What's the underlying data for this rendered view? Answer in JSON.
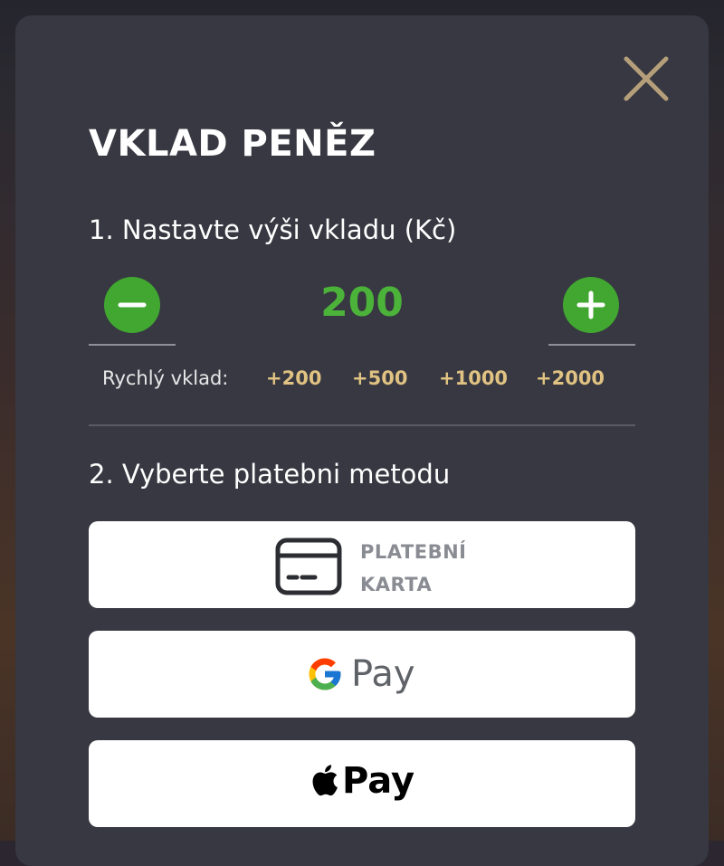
{
  "modal": {
    "title": "VKLAD PENĚZ",
    "close_icon": "close-icon"
  },
  "amount_step": {
    "heading": "1. Nastavte výši vkladu (Kč)",
    "value": "200",
    "decrease_icon": "minus-icon",
    "increase_icon": "plus-icon",
    "quick_label": "Rychlý vklad:",
    "quick_options": [
      "+200",
      "+500",
      "+1000",
      "+2000"
    ]
  },
  "method_step": {
    "heading": "2. Vyberte platebni metodu",
    "methods": [
      {
        "id": "card",
        "icon": "credit-card-icon",
        "label_line1": "PLATEBNÍ",
        "label_line2": "KARTA"
      },
      {
        "id": "google-pay",
        "icon": "google-g-icon",
        "label": "Pay"
      },
      {
        "id": "apple-pay",
        "icon": "apple-icon",
        "label": "Pay"
      }
    ]
  },
  "colors": {
    "accent_green": "#41a731",
    "amount_green": "#4cb33a",
    "quick_gold": "#e0c282",
    "close_gold": "#b59f7a",
    "modal_bg": "#373841"
  }
}
